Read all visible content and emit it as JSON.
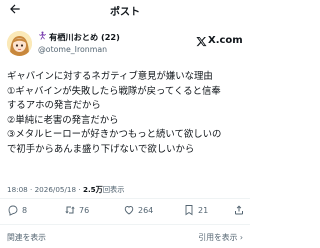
{
  "header": {
    "title": "ポスト",
    "back_icon": "arrow-left-icon"
  },
  "author": {
    "display_name": "有栖川おとめ (22)",
    "handle": "@otome_Ironman",
    "name_prefix_icon": "dancer-icon",
    "avatar_icon": "anime-girl-avatar"
  },
  "brand": {
    "logo_text": "X.com"
  },
  "post": {
    "lines": [
      "ギャバインに対するネガティブ意見が嫌いな理由",
      "①ギャバインが失敗したら戦隊が戻ってくると信奉",
      "するアホの発言だから",
      "②単純に老害の発言だから",
      "③メタルヒーローが好きかつもっと続いて欲しいの",
      "で初手からあんま盛り下げないで欲しいから"
    ]
  },
  "meta": {
    "time": "18:08",
    "separator": "·",
    "date": "2026/05/18",
    "views_count": "2.5万",
    "views_label": "回表示"
  },
  "actions": {
    "replies": "8",
    "reposts": "76",
    "likes": "264",
    "bookmarks": "21"
  },
  "footer": {
    "left_link": "関連を表示",
    "right_link": "引用を表示",
    "right_arrow": "›"
  },
  "colors": {
    "text": "#0f1419",
    "muted": "#536471",
    "divider": "#eff3f4"
  }
}
